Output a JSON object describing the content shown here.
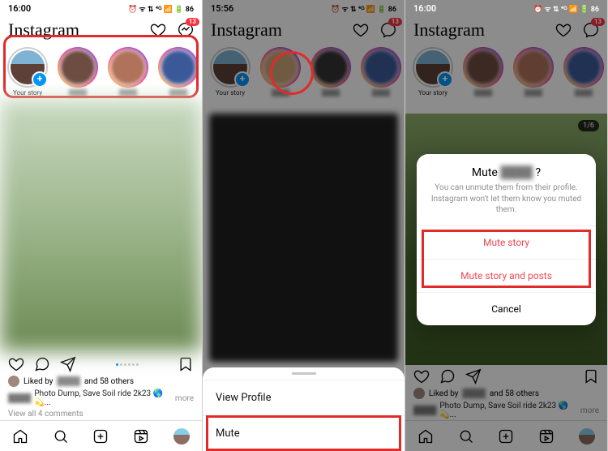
{
  "screens": [
    {
      "time": "16:00",
      "status_icons": "⏰ ᯤ ⇅ ⁴ᴳ 📶 🔋 86"
    },
    {
      "time": "15:56",
      "status_icons": "⏰ ᯤ ⇅ ⁴ᴳ 📶 🔋 86"
    },
    {
      "time": "16:00",
      "status_icons": "⏰ ᯤ ⇅ ⁴ᴳ 📶 🔋 86"
    }
  ],
  "logo": "Instagram",
  "dm_badge": "13",
  "stories": {
    "your_label": "Your story"
  },
  "post": {
    "liked_prefix": "Liked by",
    "liked_suffix": "and 58 others",
    "caption_text": "Photo Dump, Save Soil ride 2k23 🌎💫...",
    "more": "more",
    "view_comments": "View all 4 comments"
  },
  "sheet": {
    "view_profile": "View Profile",
    "mute": "Mute"
  },
  "action_sheet": {
    "title_prefix": "Mute",
    "title_suffix": "?",
    "description": "You can unmute them from their profile. Instagram won't let them know you muted them.",
    "mute_story": "Mute story",
    "mute_story_posts": "Mute story and posts",
    "cancel": "Cancel"
  },
  "pager": "1/6"
}
